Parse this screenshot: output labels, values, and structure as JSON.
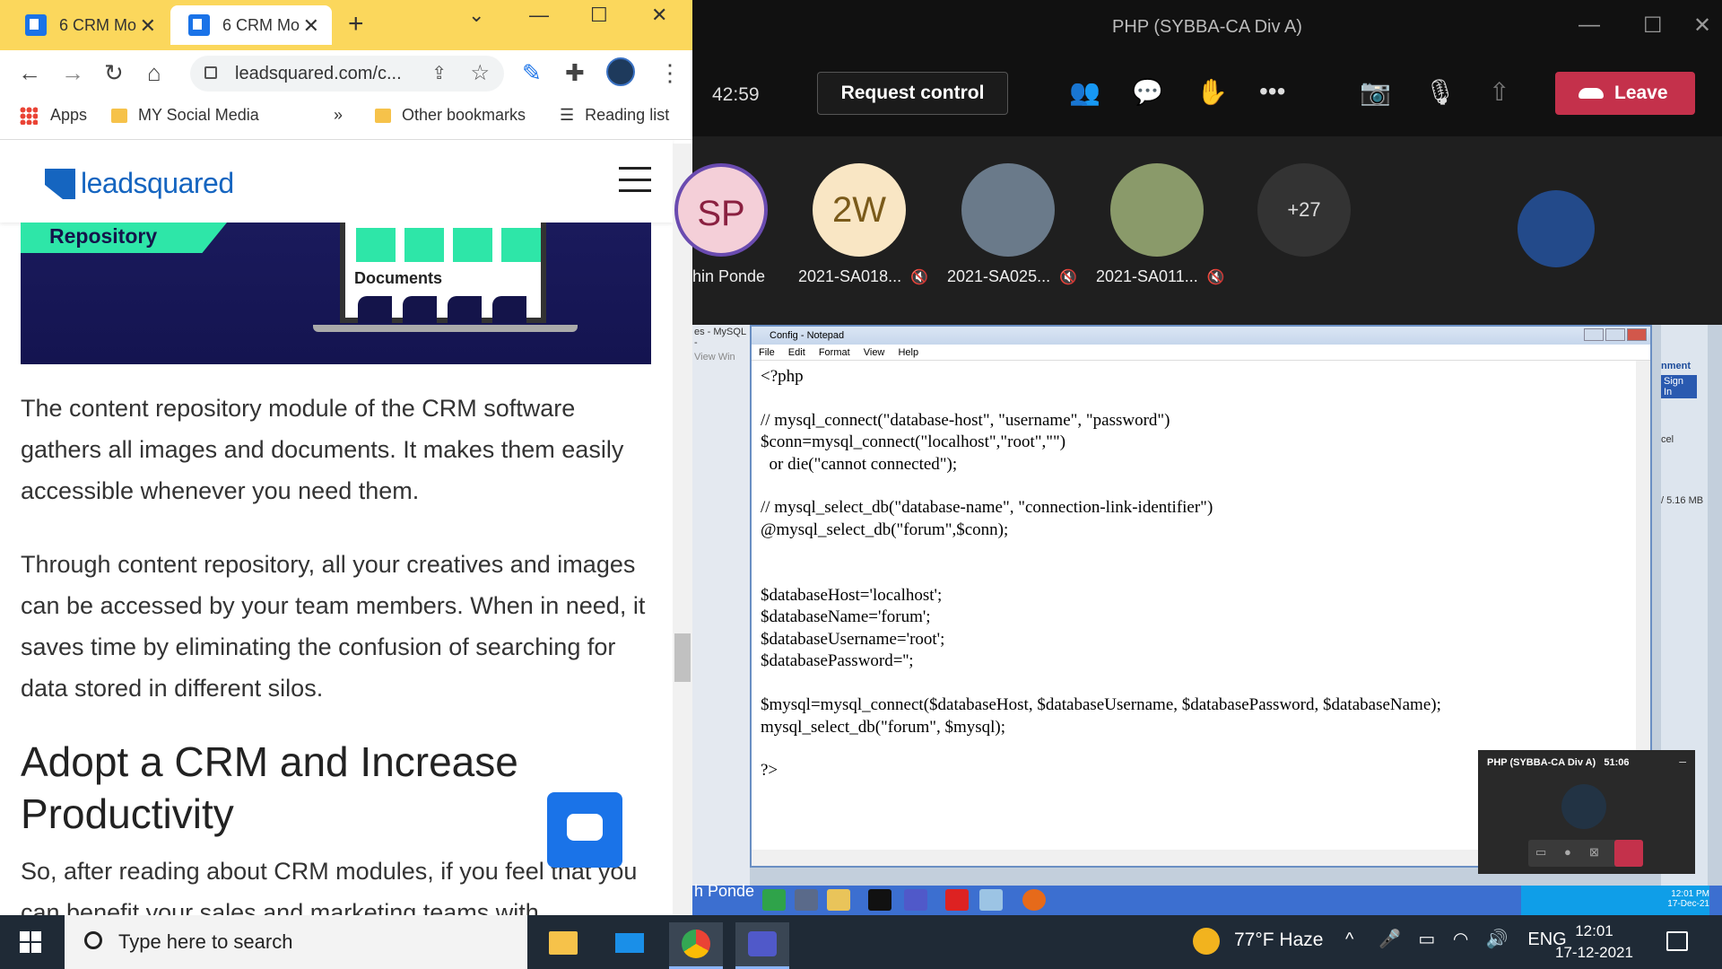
{
  "chrome": {
    "tabs": [
      {
        "title": "6 CRM Mo",
        "active": false
      },
      {
        "title": "6 CRM Mo",
        "active": true
      }
    ],
    "url": "leadsquared.com/c...",
    "bookmarks": {
      "apps": "Apps",
      "social": "MY Social Media",
      "more": "»",
      "other": "Other bookmarks",
      "reading": "Reading list"
    },
    "accent": "#fbd75c"
  },
  "page": {
    "logo": "leadsquared",
    "hero": {
      "banner": "Repository",
      "documents": "Documents"
    },
    "paragraph1": "The content repository module of the CRM software gathers all images and documents. It makes them easily accessible whenever you need them.",
    "paragraph2": "Through content repository, all your creatives and images can be accessed by your team members. When in need, it saves time by eliminating the confusion of searching for data stored in different silos.",
    "heading": "Adopt a CRM and Increase Productivity",
    "paragraph3": "So, after reading about CRM modules, if you feel that you can benefit your sales and marketing teams with"
  },
  "teams": {
    "title": "PHP (SYBBA-CA Div A)",
    "timer": "42:59",
    "request_control": "Request control",
    "leave": "Leave",
    "leave_color": "#c4314b",
    "participants": [
      {
        "initials": "SP",
        "name": "hin Ponde"
      },
      {
        "initials": "2W",
        "name": "2021-SA018..."
      },
      {
        "initials": "",
        "name": "2021-SA025..."
      },
      {
        "initials": "",
        "name": "2021-SA011..."
      },
      {
        "initials": "+27",
        "name": ""
      }
    ],
    "shared_label": "h Ponde"
  },
  "notepad": {
    "title": "Config - Notepad",
    "menu": [
      "File",
      "Edit",
      "Format",
      "View",
      "Help"
    ],
    "left_strip": [
      "es - MySQL -",
      "View  Win"
    ],
    "right_strip": [
      "nment",
      "Sign In",
      "cel",
      "/ 5.16 MB"
    ],
    "code": "<?php\n\n// mysql_connect(\"database-host\", \"username\", \"password\")\n$conn=mysql_connect(\"localhost\",\"root\",\"\")\n  or die(\"cannot connected\");\n\n// mysql_select_db(\"database-name\", \"connection-link-identifier\")\n@mysql_select_db(\"forum\",$conn);\n\n\n$databaseHost='localhost';\n$databaseName='forum';\n$databaseUsername='root';\n$databasePassword='';\n\n$mysql=mysql_connect($databaseHost, $databaseUsername, $databasePassword, $databaseName);\nmysql_select_db(\"forum\", $mysql);\n\n?>",
    "xp_clock_time": "12:01 PM",
    "xp_clock_date": "17-Dec-21"
  },
  "pip": {
    "title": "PHP (SYBBA-CA Div A)",
    "time": "51:06"
  },
  "taskbar": {
    "search_placeholder": "Type here to search",
    "weather": "77°F  Haze",
    "lang": "ENG",
    "time": "12:01",
    "date": "17-12-2021"
  }
}
